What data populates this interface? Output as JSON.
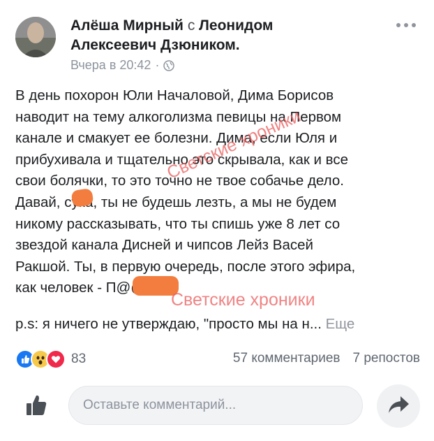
{
  "post": {
    "author": "Алёша Мирный",
    "with_word": "с",
    "tagged": "Леонидом",
    "tagged_line2": "Алексеевич Дзюником.",
    "timestamp": "Вчера в 20:42",
    "dot": "·",
    "privacy_icon": "globe-icon",
    "more_icon": "more-horizontal-icon",
    "text_lines": [
      "В день похорон Юли Началовой, Дима Борисов",
      "наводит на тему алкоголизма певицы на Первом",
      "канале и смакует ее болезни. Дима, если Юля и",
      "прибухивала и тщательно это скрывала, как и все",
      "свои болячки, то это точно не твое собачье дело.",
      "Давай, сука, ты не будешь лезть, а мы не будем",
      "никому рассказывать, что ты спишь уже 8 лет со",
      "звездой канала Дисней и чипсов Лейз Васей",
      "Ракшой. Ты, в первую очередь, после этого эфира,",
      "как человек - П@@Р!"
    ],
    "ps_text": "p.s:  я ничего не утверждаю, \"просто мы на н...",
    "more_link": "Еще"
  },
  "watermark": "Светские хроники",
  "reactions": {
    "icons": [
      "like-icon",
      "wow-icon",
      "love-icon"
    ],
    "count": "83",
    "comments": "57 комментариев",
    "shares": "7 репостов"
  },
  "composer": {
    "placeholder": "Оставьте комментарий..."
  },
  "colors": {
    "text": "#1c1e21",
    "meta": "#8d949e",
    "like_blue": "#1877f2",
    "love_red": "#f0284a",
    "wow_yellow": "#f7c94b",
    "censor_orange": "#f27d3e",
    "watermark": "#eb5a5a"
  }
}
